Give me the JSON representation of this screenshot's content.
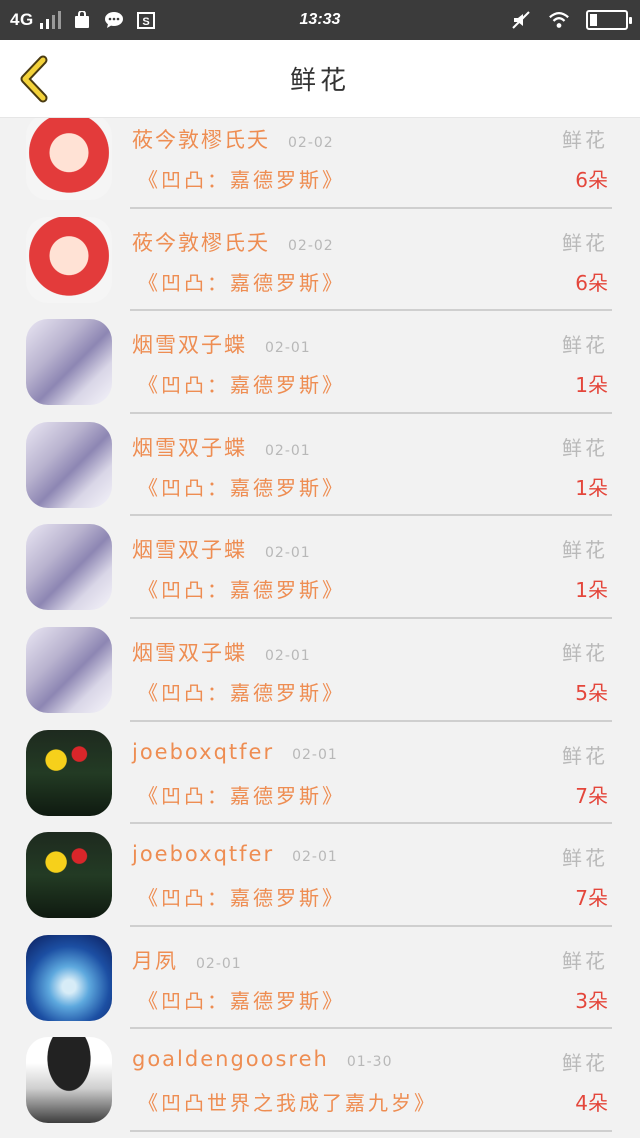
{
  "status_bar": {
    "network": "4G",
    "time": "13:33",
    "icons": [
      "signal-icon",
      "bag-icon",
      "chat-icon",
      "screenshot-icon",
      "mute-icon",
      "wifi-icon",
      "battery-icon"
    ]
  },
  "nav": {
    "title": "鲜花",
    "back_icon": "chevron-left-icon"
  },
  "colors": {
    "accent": "#ee8d52",
    "count": "#e4463b",
    "muted": "#b9b9b9"
  },
  "rows": [
    {
      "name": "莜今敦樛氏夭",
      "date": "02-02",
      "label": "鲜花",
      "book": "《凹凸：嘉德罗斯》",
      "count": "6朵",
      "avatar": "red"
    },
    {
      "name": "莜今敦樛氏夭",
      "date": "02-02",
      "label": "鲜花",
      "book": "《凹凸：嘉德罗斯》",
      "count": "6朵",
      "avatar": "red"
    },
    {
      "name": "烟雪双子蝶",
      "date": "02-01",
      "label": "鲜花",
      "book": "《凹凸：嘉德罗斯》",
      "count": "1朵",
      "avatar": "anime"
    },
    {
      "name": "烟雪双子蝶",
      "date": "02-01",
      "label": "鲜花",
      "book": "《凹凸：嘉德罗斯》",
      "count": "1朵",
      "avatar": "anime"
    },
    {
      "name": "烟雪双子蝶",
      "date": "02-01",
      "label": "鲜花",
      "book": "《凹凸：嘉德罗斯》",
      "count": "1朵",
      "avatar": "anime"
    },
    {
      "name": "烟雪双子蝶",
      "date": "02-01",
      "label": "鲜花",
      "book": "《凹凸：嘉德罗斯》",
      "count": "5朵",
      "avatar": "anime"
    },
    {
      "name": "joeboxqtfer",
      "date": "02-01",
      "label": "鲜花",
      "book": "《凹凸：嘉德罗斯》",
      "count": "7朵",
      "avatar": "lantern"
    },
    {
      "name": "joeboxqtfer",
      "date": "02-01",
      "label": "鲜花",
      "book": "《凹凸：嘉德罗斯》",
      "count": "7朵",
      "avatar": "lantern"
    },
    {
      "name": "月夙",
      "date": "02-01",
      "label": "鲜花",
      "book": "《凹凸：嘉德罗斯》",
      "count": "3朵",
      "avatar": "sky"
    },
    {
      "name": "goaldengoosreh",
      "date": "01-30",
      "label": "鲜花",
      "book": "《凹凸世界之我成了嘉九岁》",
      "count": "4朵",
      "avatar": "hat"
    }
  ]
}
